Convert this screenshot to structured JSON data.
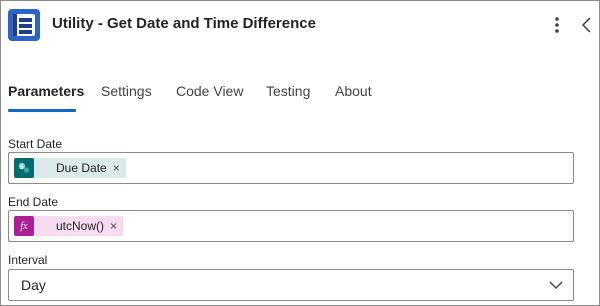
{
  "header": {
    "title": "Utility - Get Date and Time Difference",
    "app_icon": "utility-connector-icon",
    "more_icon": "more-vertical-icon",
    "collapse_icon": "chevron-left-icon"
  },
  "tabs": [
    {
      "label": "Parameters",
      "active": true
    },
    {
      "label": "Settings",
      "active": false
    },
    {
      "label": "Code View",
      "active": false
    },
    {
      "label": "Testing",
      "active": false
    },
    {
      "label": "About",
      "active": false
    }
  ],
  "fields": {
    "start_date": {
      "label": "Start Date",
      "token": {
        "label": "Due Date",
        "remove": "×",
        "icon": "sharepoint-icon",
        "icon_color": "#036c70",
        "bg_color": "#dbe9e8"
      }
    },
    "end_date": {
      "label": "End Date",
      "token": {
        "label": "utcNow()",
        "remove": "×",
        "icon": "function-icon",
        "icon_glyph": "fx",
        "icon_color": "#ad1f96",
        "bg_color": "#f7dcf1"
      }
    },
    "interval": {
      "label": "Interval",
      "value": "Day",
      "icon": "chevron-down-icon"
    }
  },
  "colors": {
    "accent": "#0f6cbd",
    "border": "#8a8a8a"
  }
}
